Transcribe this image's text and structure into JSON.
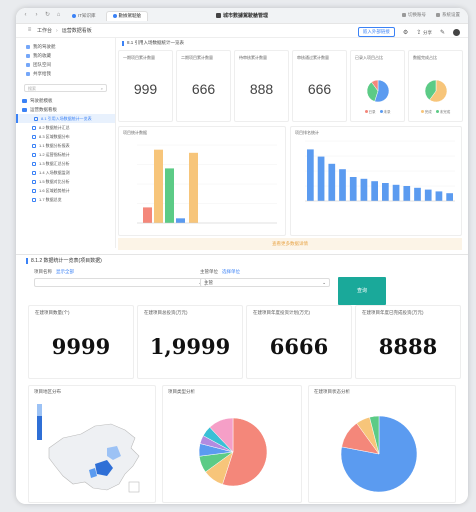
{
  "browser": {
    "tabs": [
      "IT知识库",
      "數據駕駛艙"
    ],
    "window_title": "城市數據駕駛艙管理",
    "right_links": [
      "切换账号",
      "系统设置"
    ]
  },
  "appbar": {
    "crumbs": [
      "工作台",
      "运营数据看板"
    ],
    "action_label": "嵌入外部链接",
    "share_label": "分享"
  },
  "sidebar": {
    "top_items": [
      "我的驾驶舱",
      "我的收藏",
      "团队空间",
      "共享给我"
    ],
    "search_placeholder": "搜索",
    "folders": [
      "驾驶舱模板",
      "运营数据看板"
    ],
    "sub_items": [
      "8.1 引用入场数据统计一览表",
      "8.2 数据统计汇总",
      "8.3 区域数据分布",
      "1.1 数据分析报表",
      "1.2 运营指标统计",
      "1.3 数据汇总分析",
      "1.4 入场数据监测",
      "1.5 数据对比分析",
      "1.6 区域趋势统计",
      "1.7 数据总览"
    ]
  },
  "dashboard": {
    "title": "8.1 引用入场数据统计一览表",
    "kpis": [
      {
        "label": "一期项目累计数量",
        "value": "999"
      },
      {
        "label": "二期项目累计数量",
        "value": "666"
      },
      {
        "label": "待审核累计数量",
        "value": "888"
      },
      {
        "label": "审核通过累计数量",
        "value": "666"
      },
      {
        "label": "已录入项目占比",
        "pie": [
          0.55,
          0.35,
          0.1
        ],
        "legend": [
          "已录",
          "未录"
        ]
      },
      {
        "label": "数据完成占比",
        "pie": [
          0.6,
          0.4
        ],
        "legend": [
          "完成",
          "未完成"
        ]
      }
    ],
    "chart_left_label": "项目统计数据",
    "chart_right_label": "项目排名统计",
    "more_label": "查看更多数据详情",
    "colors": {
      "red": "#f4877a",
      "orange": "#f7c57a",
      "green": "#5ccb86",
      "blue": "#5b9bf0",
      "teal": "#1aa99a"
    }
  },
  "lower": {
    "title": "8.1.2 数据统计一览表(项目数据)",
    "filter1": {
      "label": "项目名称",
      "link": "显示全部",
      "value": ""
    },
    "filter2": {
      "label": "主管单位",
      "link": "选择单位",
      "value": "主管"
    },
    "search_label": "查询",
    "kpis": [
      {
        "label": "在建项目数量(个)",
        "value": "9999"
      },
      {
        "label": "在建项目总投资(万元)",
        "value": "1,9999"
      },
      {
        "label": "在建项目年度投资计划(万元)",
        "value": "6666"
      },
      {
        "label": "在建项目年度已完成投资(万元)",
        "value": "8888"
      }
    ],
    "map_label": "项目地区分布",
    "pie1_label": "项目类型分析",
    "pie2_label": "在建项目状态分析"
  },
  "chart_data": [
    {
      "type": "bar",
      "categories": [
        "A",
        "B",
        "C",
        "D"
      ],
      "series": [
        {
          "values": [
            20,
            0,
            0,
            0
          ]
        },
        {
          "values": [
            94,
            90,
            0,
            0
          ]
        },
        {
          "values": [
            70,
            0,
            0,
            0
          ]
        },
        {
          "values": [
            6,
            0,
            0,
            0
          ]
        }
      ]
    },
    {
      "type": "bar",
      "categories": [
        "1",
        "2",
        "3",
        "4",
        "5",
        "6",
        "7",
        "8",
        "9",
        "10",
        "11",
        "12",
        "13",
        "14"
      ],
      "values": [
        86,
        74,
        62,
        53,
        40,
        37,
        33,
        30,
        27,
        25,
        22,
        19,
        16,
        13
      ]
    },
    {
      "type": "pie",
      "values": [
        55,
        10,
        8,
        6,
        4,
        5,
        12
      ]
    },
    {
      "type": "pie",
      "values": [
        78,
        12,
        6,
        4
      ]
    }
  ]
}
